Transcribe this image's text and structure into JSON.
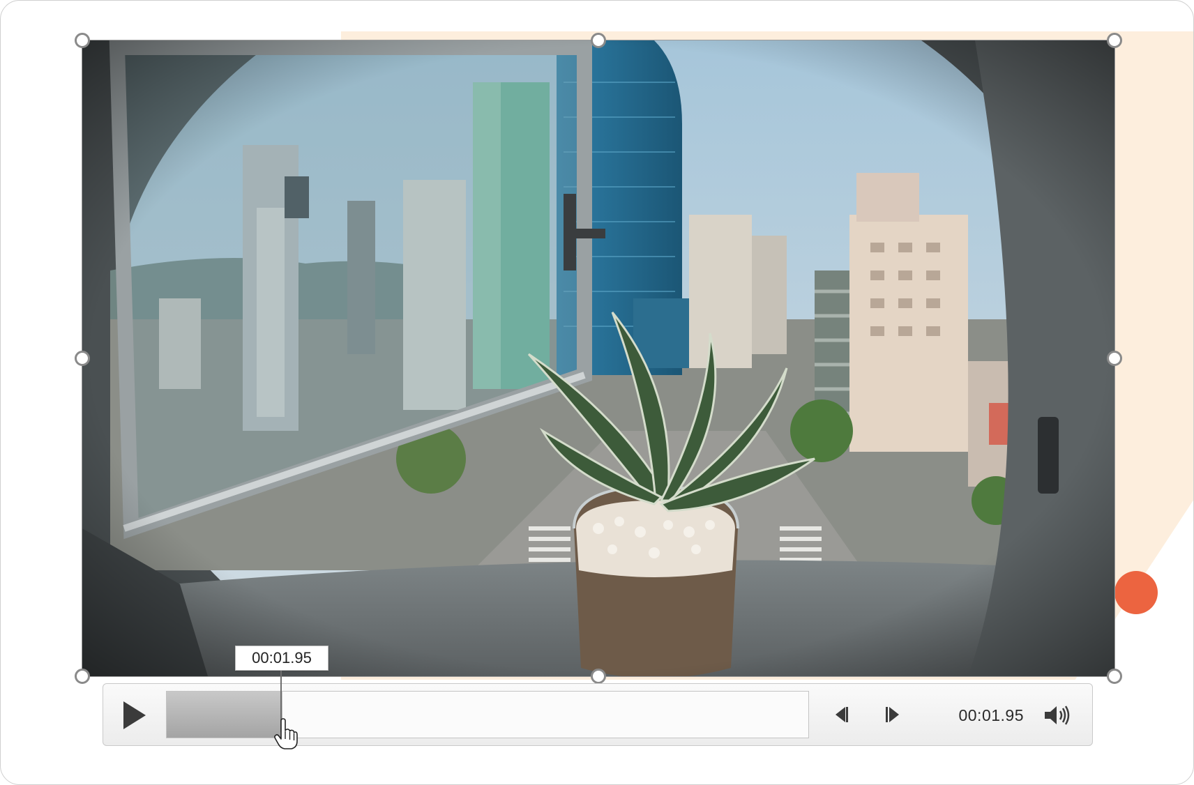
{
  "video": {
    "tooltip_time": "00:01.95",
    "current_time": "00:01.95",
    "progress_fraction": 0.18
  },
  "controls": {
    "play_icon": "play-icon",
    "prev_frame_icon": "step-back-icon",
    "next_frame_icon": "step-forward-icon",
    "volume_icon": "speaker-icon"
  },
  "colors": {
    "accent_dot": "#ec6440",
    "deco_peach": "#fdeedd"
  }
}
